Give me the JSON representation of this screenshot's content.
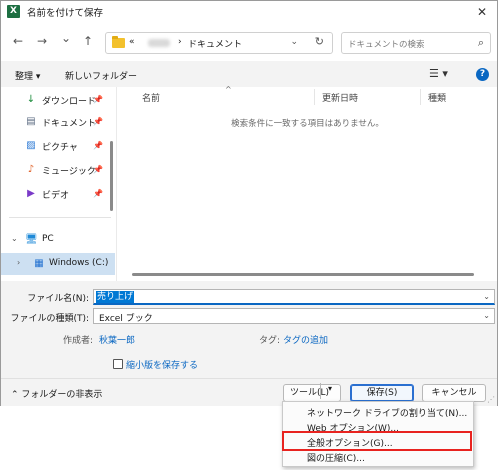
{
  "window": {
    "app_icon_letter": "X",
    "title": "名前を付けて保存",
    "close_glyph": "✕"
  },
  "nav": {
    "back_glyph": "←",
    "forward_glyph": "→",
    "recent_glyph": "⌄",
    "up_glyph": "↑",
    "breadcrumb_prefix": "«",
    "breadcrumb_current": "ドキュメント",
    "breadcrumb_sep": "›",
    "dropdown_glyph": "⌄",
    "refresh_glyph": "↻",
    "search_placeholder": "ドキュメントの検索",
    "search_glyph": "⌕"
  },
  "toolbar": {
    "organize": "整理 ▾",
    "new_folder": "新しいフォルダー",
    "view_glyph": "☰ ▾",
    "help_glyph": "?"
  },
  "sidebar": {
    "items": [
      {
        "label": "ダウンロード",
        "icon": "↓",
        "pin": "📌"
      },
      {
        "label": "ドキュメント",
        "icon": "▤",
        "pin": "📌"
      },
      {
        "label": "ピクチャ",
        "icon": "▨",
        "pin": "📌"
      },
      {
        "label": "ミュージック",
        "icon": "♪",
        "pin": "📌"
      },
      {
        "label": "ビデオ",
        "icon": "▶",
        "pin": "📌"
      }
    ],
    "pc_label": "PC",
    "pc_expand": "⌄",
    "drive_label": "Windows (C:)",
    "drive_expand": "›"
  },
  "filelist": {
    "columns": [
      "名前",
      "更新日時",
      "種類"
    ],
    "sort_caret": "^",
    "empty_message": "検索条件に一致する項目はありません。"
  },
  "form": {
    "filename_label": "ファイル名(N):",
    "filename_value": "売り上げ",
    "filetype_label": "ファイルの種類(T):",
    "filetype_value": "Excel ブック",
    "author_label": "作成者:",
    "author_value": "秋葉一郎",
    "tags_label": "タグ:",
    "tags_value": "タグの追加",
    "thumbnail_label": "縮小版を保存する",
    "chevron": "⌄"
  },
  "bottombar": {
    "hide_folders": "⌃ フォルダーの非表示",
    "tools_label": "ツール(L)",
    "tools_arrow": "▾",
    "save_label": "保存(S)",
    "cancel_label": "キャンセル",
    "grip": "⋰"
  },
  "menu": {
    "items": [
      "ネットワーク ドライブの割り当て(N)...",
      "Web オプション(W)...",
      "全般オプション(G)...",
      "図の圧縮(C)..."
    ],
    "highlight_color": "#e8231f"
  }
}
